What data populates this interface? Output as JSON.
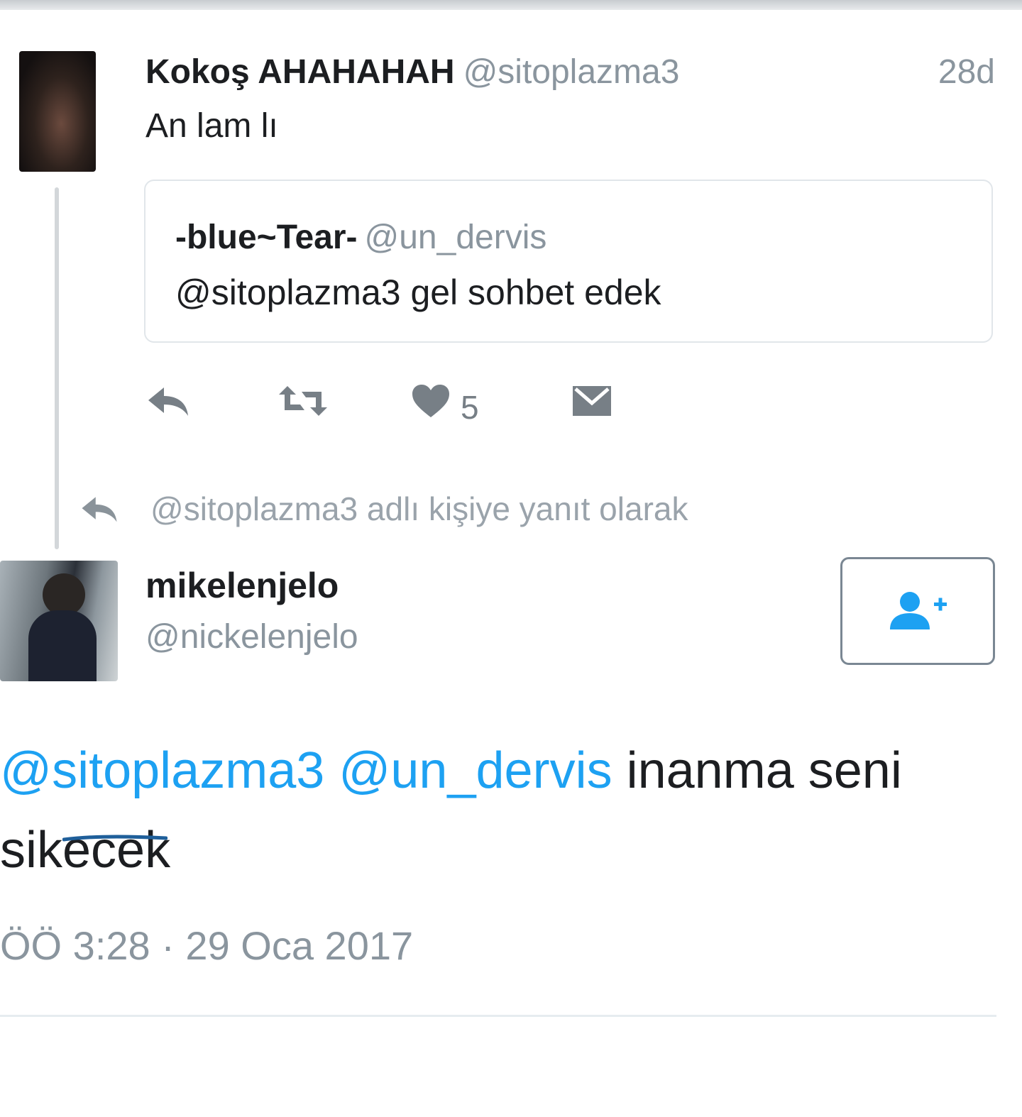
{
  "quoted_tweet": {
    "author_name": "Kokoş AHAHAHAH",
    "author_handle": "@sitoplazma3",
    "time": "28d",
    "text": "An lam lı",
    "quote": {
      "author_name": "-blue~Tear-",
      "author_handle": "@un_dervis",
      "text": "@sitoplazma3 gel sohbet edek"
    },
    "actions": {
      "reply_icon": "reply-icon",
      "retweet_icon": "retweet-icon",
      "like_icon": "heart-icon",
      "like_count": "5",
      "dm_icon": "envelope-icon"
    }
  },
  "reply_context": {
    "icon": "reply-icon",
    "text": "@sitoplazma3 adlı kişiye yanıt olarak"
  },
  "main_tweet": {
    "author_name": "mikelenjelo",
    "author_handle": "@nickelenjelo",
    "follow_icon": "add-user-icon",
    "mentions": [
      "@sitoplazma3",
      "@un_dervis"
    ],
    "text_line1": "inanma seni",
    "text_line2": "sikecek",
    "timestamp": "ÖÖ 3:28 · 29 Oca 2017"
  },
  "colors": {
    "link": "#1da1f2",
    "muted": "#8a959e",
    "text": "#1c1e21",
    "scribble": "#1f5f9a"
  }
}
